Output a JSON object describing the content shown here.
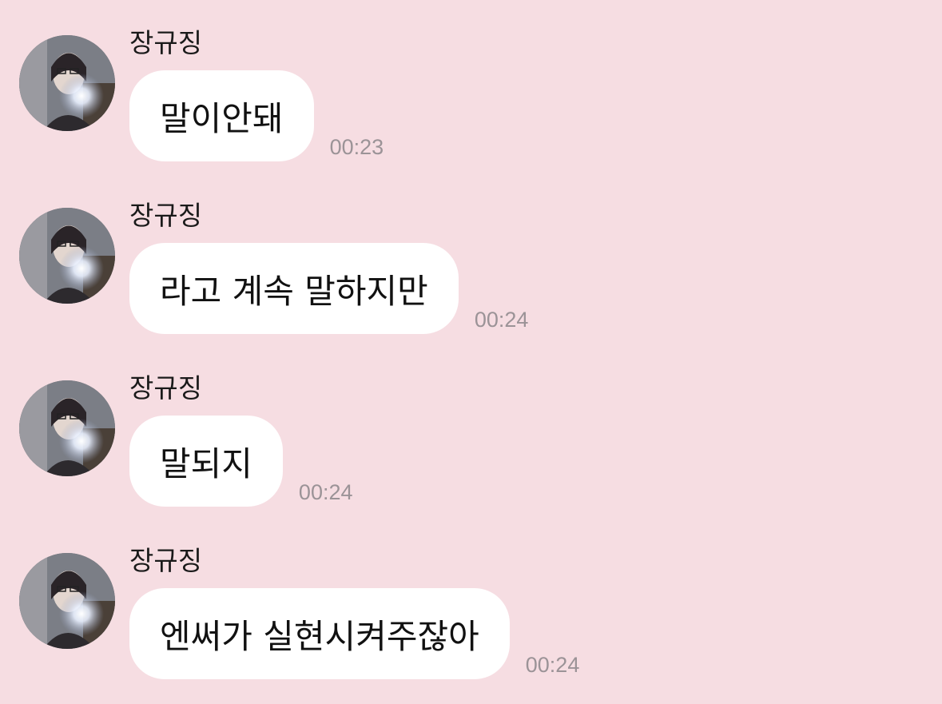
{
  "conversation": {
    "messages": [
      {
        "sender": "장규징",
        "text": "말이안돼",
        "time": "00:23"
      },
      {
        "sender": "장규징",
        "text": "라고 계속 말하지만",
        "time": "00:24"
      },
      {
        "sender": "장규징",
        "text": "말되지",
        "time": "00:24"
      },
      {
        "sender": "장규징",
        "text": "엔써가 실현시켜주잖아",
        "time": "00:24"
      }
    ]
  },
  "colors": {
    "background": "#f6dde2",
    "bubble": "#ffffff",
    "timestamp": "#9b9397"
  }
}
